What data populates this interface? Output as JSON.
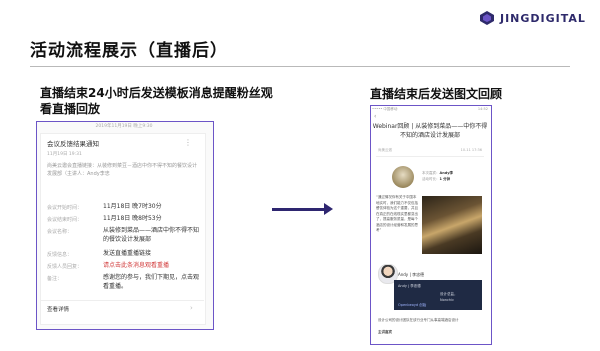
{
  "brand": {
    "name": "JINGDIGITAL",
    "color": "#2e2a6b"
  },
  "slide": {
    "title": "活动流程展示（直播后）"
  },
  "left": {
    "caption": "直播结束24小时后发送模板消息提醒粉丝观看直播回放",
    "card": {
      "date": "2019年11月19日 晚上9:30",
      "title": "会议反馈结果通知",
      "time": "11月19日 19:31",
      "desc": "尚美云邀会直播链接：从装修到菜豆－酒店中你不得不知的餐饮设计发展部（主讲人：Andy李忠",
      "rows": [
        {
          "label": "会议开始时间：",
          "value": "11月18日 晚7时30分",
          "red": false
        },
        {
          "label": "会议结束时间：",
          "value": "11月18日 晚8时53分",
          "red": false
        },
        {
          "label": "会议名称：",
          "value": "从装修到菜品——酒店中你不得不知的餐饮设计发展部",
          "red": false
        },
        {
          "label": "反馈信息：",
          "value": "发送直播重播链接",
          "red": false
        },
        {
          "label": "反馈人员回复：",
          "value": "请点击此条消息观看重播",
          "red": true
        },
        {
          "label": "备注：",
          "value": "感谢您的参与，我们下期见，点击观看重播。",
          "red": false
        }
      ],
      "footer": "查看详情"
    }
  },
  "right": {
    "caption": "直播结束后发送图文回顾",
    "phone": {
      "status_left": "••••• 中国移动",
      "status_right": "14:52",
      "back": "‹",
      "title": "Webinar回顾 | 从装修到菜品——中你不得不知的酒店设计发展部",
      "meta_left": "尚美云邀",
      "meta_right": "10-11 17:36",
      "info_line1": "本次嘉宾：",
      "info_name": "Andy李",
      "info_line2": "活动时长：",
      "info_duration": "1 分钟",
      "body": "“通过情况你有关于中国本地实时，我们能力不仅包括餐饮体验为这个重要，并且在真正的在线现实里都变出了，提高服务质量，是每个酒店的设计经营和发展的思考”",
      "speaker": "Andy | 李忠德",
      "box_t1": "Andy | 李忠德",
      "box_t2": "设计总监，",
      "box_t3": "Nonchic",
      "box_t4": "Openbeoyd 创始",
      "foot1": "设计公司的设计团队在该行业专门从事高端酒店设计",
      "foot2": "主讲嘉宾"
    }
  }
}
